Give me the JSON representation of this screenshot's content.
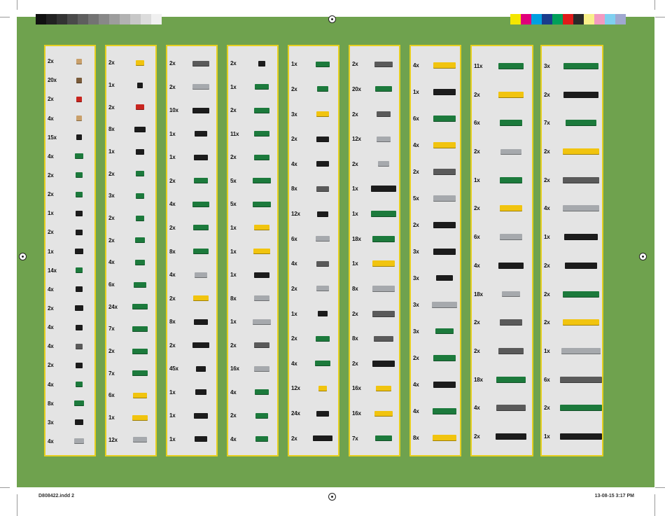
{
  "footer": {
    "file": "D808422.indd   2",
    "date": "13-08-15   3:17 PM"
  },
  "colors": {
    "green": "#1c7a3c",
    "yellow": "#f1c40f",
    "black": "#1c1c1c",
    "dark_gray": "#5a5a5a",
    "light_gray": "#a6a9ad",
    "tan": "#c9a06b",
    "red": "#c8251f",
    "brown": "#7a5b3a",
    "background": "#6fa24e",
    "panel": "#e4e4e4",
    "border": "#e6cf20"
  },
  "swatches_left": [
    "#111111",
    "#222222",
    "#333333",
    "#4a4a4a",
    "#5e5e5e",
    "#737373",
    "#888888",
    "#9d9d9d",
    "#b2b2b2",
    "#c7c7c7",
    "#dcdcdc",
    "#f0f0f0"
  ],
  "swatches_right": [
    "#f4e600",
    "#e0007a",
    "#00a0e0",
    "#1a3c8c",
    "#00a05a",
    "#e01a1a",
    "#2a2a2a",
    "#f8f08a",
    "#f29ac0",
    "#7fd0f0",
    "#a0a8d0"
  ],
  "columns": [
    {
      "items": [
        {
          "qty": "2x",
          "color": "tan",
          "w": 8
        },
        {
          "qty": "20x",
          "color": "brown",
          "w": 8
        },
        {
          "qty": "2x",
          "color": "red",
          "w": 8
        },
        {
          "qty": "4x",
          "color": "tan",
          "w": 8
        },
        {
          "qty": "15x",
          "color": "black",
          "w": 8
        },
        {
          "qty": "4x",
          "color": "green",
          "w": 12
        },
        {
          "qty": "2x",
          "color": "green",
          "w": 10
        },
        {
          "qty": "2x",
          "color": "green",
          "w": 10
        },
        {
          "qty": "1x",
          "color": "black",
          "w": 10
        },
        {
          "qty": "2x",
          "color": "black",
          "w": 10
        },
        {
          "qty": "1x",
          "color": "black",
          "w": 12
        },
        {
          "qty": "14x",
          "color": "green",
          "w": 10
        },
        {
          "qty": "4x",
          "color": "black",
          "w": 10
        },
        {
          "qty": "2x",
          "color": "black",
          "w": 12
        },
        {
          "qty": "4x",
          "color": "black",
          "w": 10
        },
        {
          "qty": "4x",
          "color": "dark_gray",
          "w": 10
        },
        {
          "qty": "2x",
          "color": "black",
          "w": 10
        },
        {
          "qty": "4x",
          "color": "green",
          "w": 10
        },
        {
          "qty": "8x",
          "color": "green",
          "w": 14
        },
        {
          "qty": "3x",
          "color": "black",
          "w": 12
        },
        {
          "qty": "4x",
          "color": "light_gray",
          "w": 14
        }
      ]
    },
    {
      "items": [
        {
          "qty": "2x",
          "color": "yellow",
          "w": 12
        },
        {
          "qty": "1x",
          "color": "black",
          "w": 8
        },
        {
          "qty": "2x",
          "color": "red",
          "w": 12
        },
        {
          "qty": "8x",
          "color": "black",
          "w": 16
        },
        {
          "qty": "1x",
          "color": "black",
          "w": 12
        },
        {
          "qty": "2x",
          "color": "green",
          "w": 12
        },
        {
          "qty": "3x",
          "color": "green",
          "w": 12
        },
        {
          "qty": "2x",
          "color": "green",
          "w": 12
        },
        {
          "qty": "2x",
          "color": "green",
          "w": 14
        },
        {
          "qty": "4x",
          "color": "green",
          "w": 14
        },
        {
          "qty": "6x",
          "color": "green",
          "w": 18
        },
        {
          "qty": "24x",
          "color": "green",
          "w": 22
        },
        {
          "qty": "7x",
          "color": "green",
          "w": 22
        },
        {
          "qty": "2x",
          "color": "green",
          "w": 22
        },
        {
          "qty": "7x",
          "color": "green",
          "w": 22
        },
        {
          "qty": "6x",
          "color": "yellow",
          "w": 20
        },
        {
          "qty": "1x",
          "color": "yellow",
          "w": 22
        },
        {
          "qty": "12x",
          "color": "light_gray",
          "w": 20
        }
      ]
    },
    {
      "items": [
        {
          "qty": "2x",
          "color": "dark_gray",
          "w": 24
        },
        {
          "qty": "2x",
          "color": "light_gray",
          "w": 24
        },
        {
          "qty": "10x",
          "color": "black",
          "w": 24
        },
        {
          "qty": "1x",
          "color": "black",
          "w": 18
        },
        {
          "qty": "1x",
          "color": "black",
          "w": 20
        },
        {
          "qty": "2x",
          "color": "green",
          "w": 20
        },
        {
          "qty": "4x",
          "color": "green",
          "w": 24
        },
        {
          "qty": "2x",
          "color": "green",
          "w": 22
        },
        {
          "qty": "8x",
          "color": "green",
          "w": 22
        },
        {
          "qty": "4x",
          "color": "light_gray",
          "w": 18
        },
        {
          "qty": "2x",
          "color": "yellow",
          "w": 22
        },
        {
          "qty": "8x",
          "color": "black",
          "w": 20
        },
        {
          "qty": "2x",
          "color": "black",
          "w": 24
        },
        {
          "qty": "45x",
          "color": "black",
          "w": 14
        },
        {
          "qty": "1x",
          "color": "black",
          "w": 16
        },
        {
          "qty": "1x",
          "color": "black",
          "w": 20
        },
        {
          "qty": "1x",
          "color": "black",
          "w": 18
        }
      ]
    },
    {
      "items": [
        {
          "qty": "2x",
          "color": "black",
          "w": 10
        },
        {
          "qty": "1x",
          "color": "green",
          "w": 20
        },
        {
          "qty": "2x",
          "color": "green",
          "w": 22
        },
        {
          "qty": "11x",
          "color": "green",
          "w": 22
        },
        {
          "qty": "2x",
          "color": "green",
          "w": 22
        },
        {
          "qty": "5x",
          "color": "green",
          "w": 26
        },
        {
          "qty": "5x",
          "color": "green",
          "w": 26
        },
        {
          "qty": "1x",
          "color": "yellow",
          "w": 22
        },
        {
          "qty": "1x",
          "color": "yellow",
          "w": 24
        },
        {
          "qty": "1x",
          "color": "black",
          "w": 22
        },
        {
          "qty": "8x",
          "color": "light_gray",
          "w": 22
        },
        {
          "qty": "1x",
          "color": "light_gray",
          "w": 26
        },
        {
          "qty": "2x",
          "color": "dark_gray",
          "w": 22
        },
        {
          "qty": "16x",
          "color": "light_gray",
          "w": 22
        },
        {
          "qty": "4x",
          "color": "green",
          "w": 20
        },
        {
          "qty": "2x",
          "color": "green",
          "w": 18
        },
        {
          "qty": "4x",
          "color": "green",
          "w": 18
        }
      ]
    },
    {
      "items": [
        {
          "qty": "1x",
          "color": "green",
          "w": 20
        },
        {
          "qty": "2x",
          "color": "green",
          "w": 16
        },
        {
          "qty": "3x",
          "color": "yellow",
          "w": 18
        },
        {
          "qty": "2x",
          "color": "black",
          "w": 18
        },
        {
          "qty": "4x",
          "color": "black",
          "w": 18
        },
        {
          "qty": "8x",
          "color": "dark_gray",
          "w": 18
        },
        {
          "qty": "12x",
          "color": "black",
          "w": 16
        },
        {
          "qty": "6x",
          "color": "light_gray",
          "w": 20
        },
        {
          "qty": "4x",
          "color": "dark_gray",
          "w": 18
        },
        {
          "qty": "2x",
          "color": "light_gray",
          "w": 18
        },
        {
          "qty": "1x",
          "color": "black",
          "w": 14
        },
        {
          "qty": "2x",
          "color": "green",
          "w": 20
        },
        {
          "qty": "4x",
          "color": "green",
          "w": 22
        },
        {
          "qty": "12x",
          "color": "yellow",
          "w": 12
        },
        {
          "qty": "24x",
          "color": "black",
          "w": 18
        },
        {
          "qty": "2x",
          "color": "black",
          "w": 28
        }
      ]
    },
    {
      "items": [
        {
          "qty": "2x",
          "color": "dark_gray",
          "w": 26
        },
        {
          "qty": "20x",
          "color": "green",
          "w": 24
        },
        {
          "qty": "2x",
          "color": "dark_gray",
          "w": 20
        },
        {
          "qty": "12x",
          "color": "light_gray",
          "w": 20
        },
        {
          "qty": "2x",
          "color": "light_gray",
          "w": 16
        },
        {
          "qty": "1x",
          "color": "black",
          "w": 36
        },
        {
          "qty": "1x",
          "color": "green",
          "w": 36
        },
        {
          "qty": "18x",
          "color": "green",
          "w": 32
        },
        {
          "qty": "1x",
          "color": "yellow",
          "w": 32
        },
        {
          "qty": "8x",
          "color": "light_gray",
          "w": 32
        },
        {
          "qty": "2x",
          "color": "dark_gray",
          "w": 32
        },
        {
          "qty": "8x",
          "color": "dark_gray",
          "w": 28
        },
        {
          "qty": "2x",
          "color": "black",
          "w": 32
        },
        {
          "qty": "16x",
          "color": "yellow",
          "w": 22
        },
        {
          "qty": "16x",
          "color": "yellow",
          "w": 26
        },
        {
          "qty": "7x",
          "color": "green",
          "w": 24
        }
      ]
    },
    {
      "items": [
        {
          "qty": "4x",
          "color": "yellow",
          "w": 32
        },
        {
          "qty": "1x",
          "color": "black",
          "w": 32
        },
        {
          "qty": "6x",
          "color": "green",
          "w": 32
        },
        {
          "qty": "4x",
          "color": "yellow",
          "w": 32
        },
        {
          "qty": "2x",
          "color": "dark_gray",
          "w": 32
        },
        {
          "qty": "5x",
          "color": "light_gray",
          "w": 32
        },
        {
          "qty": "2x",
          "color": "black",
          "w": 32
        },
        {
          "qty": "3x",
          "color": "black",
          "w": 32
        },
        {
          "qty": "3x",
          "color": "black",
          "w": 24
        },
        {
          "qty": "3x",
          "color": "light_gray",
          "w": 36
        },
        {
          "qty": "3x",
          "color": "green",
          "w": 26
        },
        {
          "qty": "2x",
          "color": "green",
          "w": 32
        },
        {
          "qty": "4x",
          "color": "black",
          "w": 32
        },
        {
          "qty": "4x",
          "color": "green",
          "w": 34
        },
        {
          "qty": "8x",
          "color": "yellow",
          "w": 34
        }
      ]
    },
    {
      "items": [
        {
          "qty": "11x",
          "color": "green",
          "w": 36
        },
        {
          "qty": "2x",
          "color": "yellow",
          "w": 36
        },
        {
          "qty": "6x",
          "color": "green",
          "w": 32
        },
        {
          "qty": "2x",
          "color": "light_gray",
          "w": 30
        },
        {
          "qty": "1x",
          "color": "green",
          "w": 32
        },
        {
          "qty": "2x",
          "color": "yellow",
          "w": 32
        },
        {
          "qty": "6x",
          "color": "light_gray",
          "w": 32
        },
        {
          "qty": "4x",
          "color": "black",
          "w": 36
        },
        {
          "qty": "18x",
          "color": "light_gray",
          "w": 26
        },
        {
          "qty": "2x",
          "color": "dark_gray",
          "w": 32
        },
        {
          "qty": "2x",
          "color": "dark_gray",
          "w": 36
        },
        {
          "qty": "18x",
          "color": "green",
          "w": 42
        },
        {
          "qty": "4x",
          "color": "dark_gray",
          "w": 42
        },
        {
          "qty": "2x",
          "color": "black",
          "w": 44
        }
      ]
    },
    {
      "items": [
        {
          "qty": "3x",
          "color": "green",
          "w": 50
        },
        {
          "qty": "2x",
          "color": "black",
          "w": 50
        },
        {
          "qty": "7x",
          "color": "green",
          "w": 44
        },
        {
          "qty": "2x",
          "color": "yellow",
          "w": 52
        },
        {
          "qty": "2x",
          "color": "dark_gray",
          "w": 52
        },
        {
          "qty": "4x",
          "color": "light_gray",
          "w": 52
        },
        {
          "qty": "1x",
          "color": "black",
          "w": 48
        },
        {
          "qty": "2x",
          "color": "black",
          "w": 46
        },
        {
          "qty": "2x",
          "color": "green",
          "w": 52
        },
        {
          "qty": "2x",
          "color": "yellow",
          "w": 52
        },
        {
          "qty": "1x",
          "color": "light_gray",
          "w": 56
        },
        {
          "qty": "6x",
          "color": "dark_gray",
          "w": 68
        },
        {
          "qty": "2x",
          "color": "green",
          "w": 70
        },
        {
          "qty": "1x",
          "color": "black",
          "w": 72
        }
      ]
    }
  ]
}
